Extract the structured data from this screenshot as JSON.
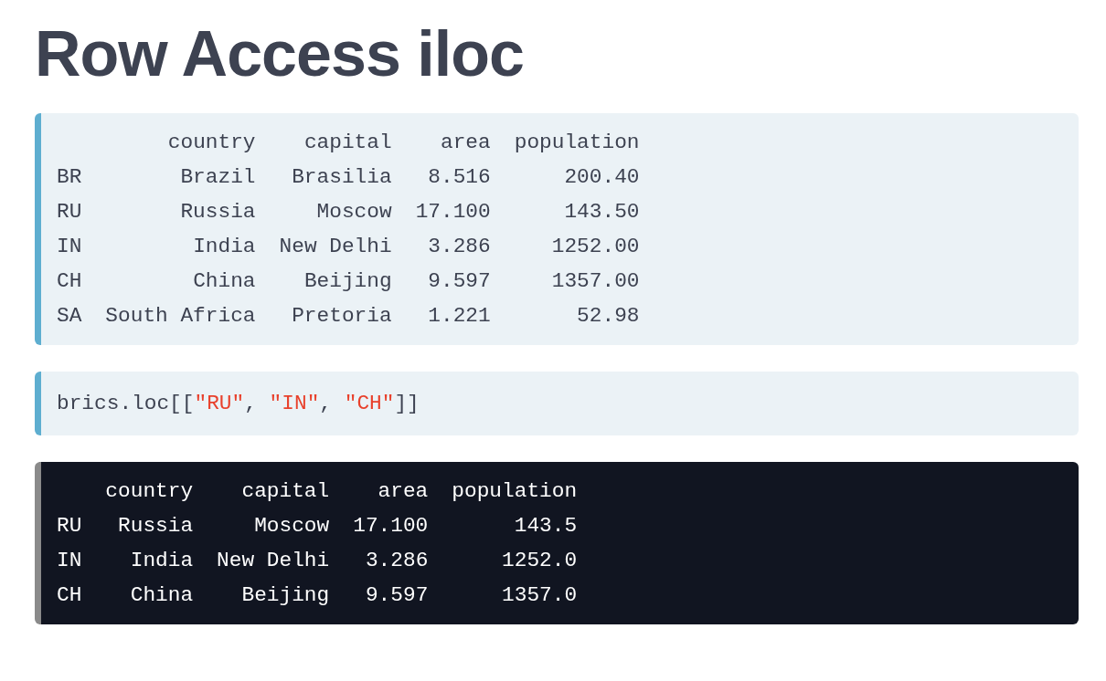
{
  "title": "Row Access iloc",
  "blocks": [
    {
      "kind": "output",
      "dark": false,
      "columns": [
        "country",
        "capital",
        "area",
        "population"
      ],
      "rows": [
        {
          "index": "BR",
          "cells": [
            "Brazil",
            "Brasilia",
            "8.516",
            "200.40"
          ]
        },
        {
          "index": "RU",
          "cells": [
            "Russia",
            "Moscow",
            "17.100",
            "143.50"
          ]
        },
        {
          "index": "IN",
          "cells": [
            "India",
            "New Delhi",
            "3.286",
            "1252.00"
          ]
        },
        {
          "index": "CH",
          "cells": [
            "China",
            "Beijing",
            "9.597",
            "1357.00"
          ]
        },
        {
          "index": "SA",
          "cells": [
            "South Africa",
            "Pretoria",
            "1.221",
            "52.98"
          ]
        }
      ]
    },
    {
      "kind": "code",
      "dark": false,
      "tokens": [
        {
          "kind": "plain",
          "text": "brics.loc[["
        },
        {
          "kind": "string",
          "text": "\"RU\""
        },
        {
          "kind": "plain",
          "text": ", "
        },
        {
          "kind": "string",
          "text": "\"IN\""
        },
        {
          "kind": "plain",
          "text": ", "
        },
        {
          "kind": "string",
          "text": "\"CH\""
        },
        {
          "kind": "plain",
          "text": "]]"
        }
      ]
    },
    {
      "kind": "output",
      "dark": true,
      "columns": [
        "country",
        "capital",
        "area",
        "population"
      ],
      "rows": [
        {
          "index": "RU",
          "cells": [
            "Russia",
            "Moscow",
            "17.100",
            "143.5"
          ]
        },
        {
          "index": "IN",
          "cells": [
            "India",
            "New Delhi",
            "3.286",
            "1252.0"
          ]
        },
        {
          "index": "CH",
          "cells": [
            "China",
            "Beijing",
            "9.597",
            "1357.0"
          ]
        }
      ]
    }
  ]
}
